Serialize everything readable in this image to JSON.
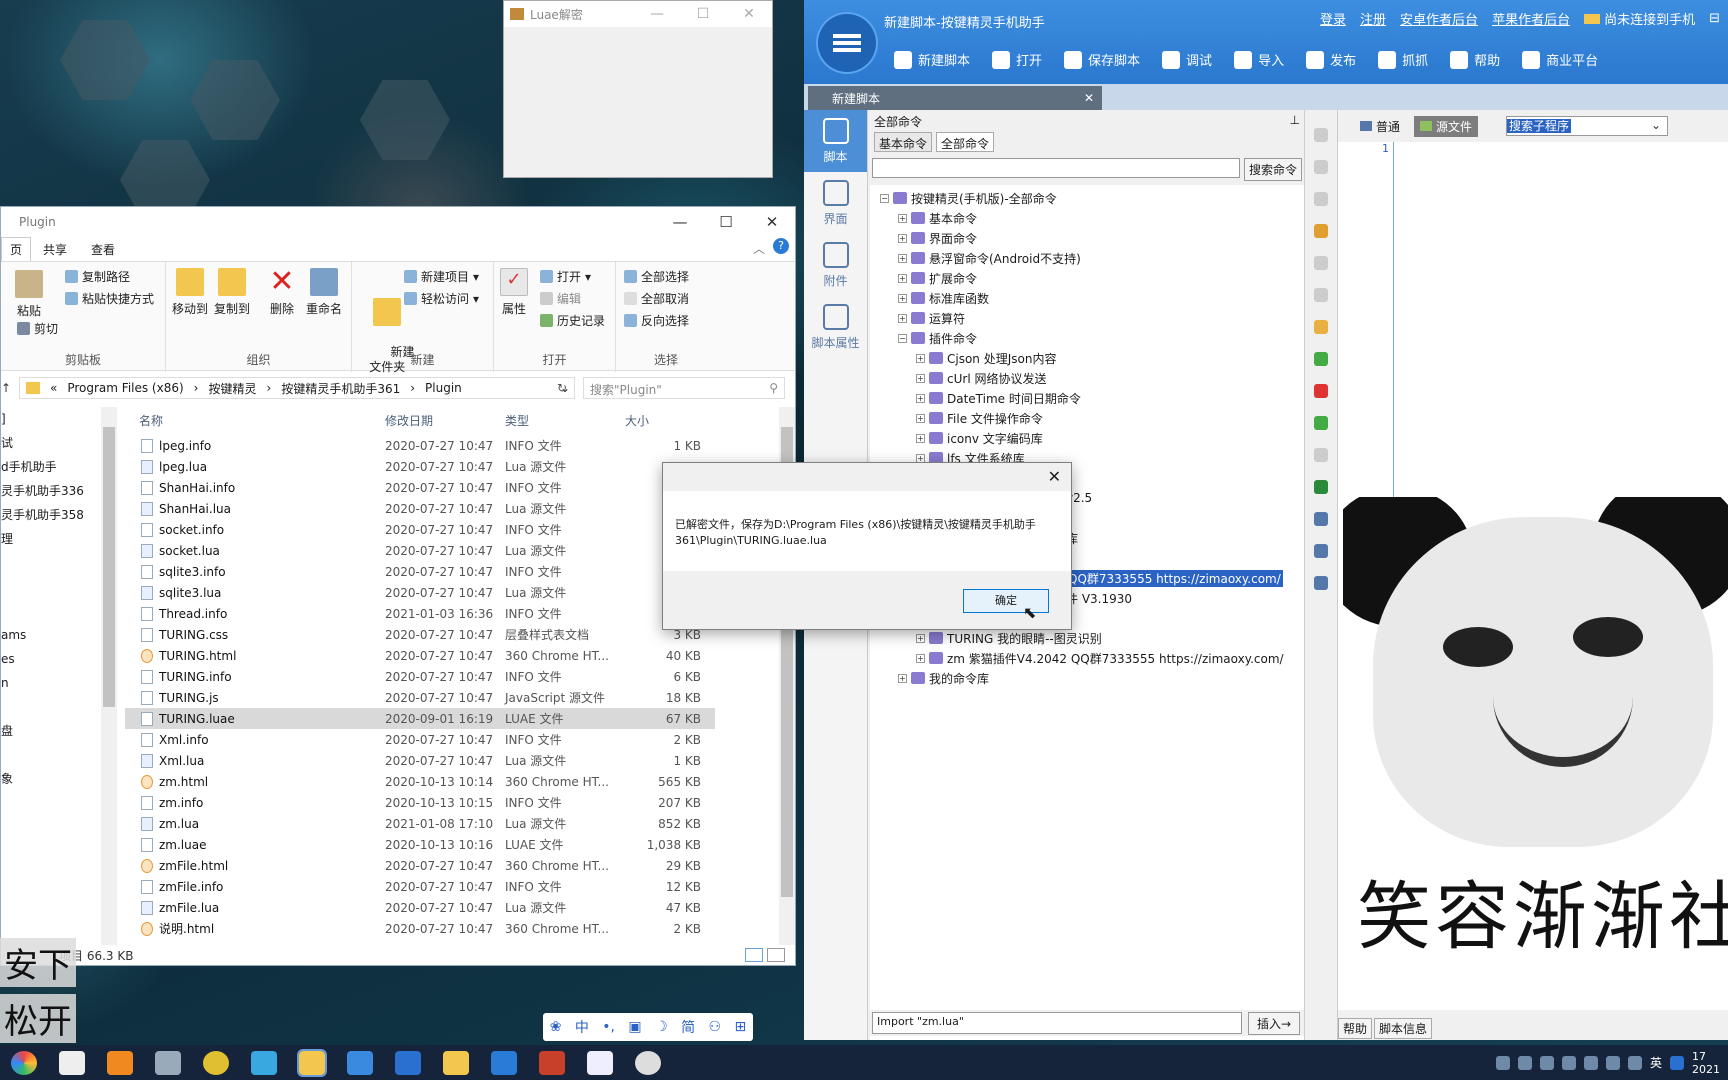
{
  "luae_window": {
    "title": "Luae解密"
  },
  "explorer": {
    "title": "Plugin",
    "tabs": [
      "页",
      "共享",
      "查看"
    ],
    "ribbon": {
      "clipboard": {
        "label": "剪贴板",
        "paste": "粘贴",
        "copy_path": "复制路径",
        "paste_shortcut": "粘贴快捷方式",
        "cut": "剪切"
      },
      "organize": {
        "label": "组织",
        "move_to": "移动到",
        "copy_to": "复制到",
        "delete": "删除",
        "rename": "重命名"
      },
      "new": {
        "label": "新建",
        "new_folder": "新建\n文件夹",
        "new_item": "新建项目",
        "easy_access": "轻松访问"
      },
      "open": {
        "label": "打开",
        "properties": "属性",
        "open": "打开",
        "edit": "编辑",
        "history": "历史记录"
      },
      "select": {
        "label": "选择",
        "select_all": "全部选择",
        "select_none": "全部取消",
        "invert": "反向选择"
      }
    },
    "path": [
      "«",
      "Program Files (x86)",
      "按键精灵",
      "按键精灵手机助手361",
      "Plugin"
    ],
    "search_placeholder": "搜索\"Plugin\"",
    "nav_items": [
      "]",
      "试",
      "d手机助手",
      "灵手机助手336",
      "灵手机助手358",
      "理",
      "",
      "",
      "",
      "ams",
      "es",
      "n",
      "",
      "盘",
      "",
      "象"
    ],
    "columns": [
      "名称",
      "修改日期",
      "类型",
      "大小"
    ],
    "files": [
      {
        "name": "lpeg.info",
        "date": "2020-07-27 10:47",
        "type": "INFO 文件",
        "size": "1 KB",
        "icon": "info"
      },
      {
        "name": "lpeg.lua",
        "date": "2020-07-27 10:47",
        "type": "Lua 源文件",
        "size": "",
        "icon": "lua"
      },
      {
        "name": "ShanHai.info",
        "date": "2020-07-27 10:47",
        "type": "INFO 文件",
        "size": "",
        "icon": "info"
      },
      {
        "name": "ShanHai.lua",
        "date": "2020-07-27 10:47",
        "type": "Lua 源文件",
        "size": "",
        "icon": "lua"
      },
      {
        "name": "socket.info",
        "date": "2020-07-27 10:47",
        "type": "INFO 文件",
        "size": "",
        "icon": "info"
      },
      {
        "name": "socket.lua",
        "date": "2020-07-27 10:47",
        "type": "Lua 源文件",
        "size": "",
        "icon": "lua"
      },
      {
        "name": "sqlite3.info",
        "date": "2020-07-27 10:47",
        "type": "INFO 文件",
        "size": "",
        "icon": "info"
      },
      {
        "name": "sqlite3.lua",
        "date": "2020-07-27 10:47",
        "type": "Lua 源文件",
        "size": "",
        "icon": "lua"
      },
      {
        "name": "Thread.info",
        "date": "2021-01-03 16:36",
        "type": "INFO 文件",
        "size": "",
        "icon": "info"
      },
      {
        "name": "TURING.css",
        "date": "2020-07-27 10:47",
        "type": "层叠样式表文档",
        "size": "3 KB",
        "icon": "info"
      },
      {
        "name": "TURING.html",
        "date": "2020-07-27 10:47",
        "type": "360 Chrome HT...",
        "size": "40 KB",
        "icon": "html"
      },
      {
        "name": "TURING.info",
        "date": "2020-07-27 10:47",
        "type": "INFO 文件",
        "size": "6 KB",
        "icon": "info"
      },
      {
        "name": "TURING.js",
        "date": "2020-07-27 10:47",
        "type": "JavaScript 源文件",
        "size": "18 KB",
        "icon": "info"
      },
      {
        "name": "TURING.luae",
        "date": "2020-09-01 16:19",
        "type": "LUAE 文件",
        "size": "67 KB",
        "icon": "info",
        "selected": true
      },
      {
        "name": "Xml.info",
        "date": "2020-07-27 10:47",
        "type": "INFO 文件",
        "size": "2 KB",
        "icon": "info"
      },
      {
        "name": "Xml.lua",
        "date": "2020-07-27 10:47",
        "type": "Lua 源文件",
        "size": "1 KB",
        "icon": "lua"
      },
      {
        "name": "zm.html",
        "date": "2020-10-13 10:14",
        "type": "360 Chrome HT...",
        "size": "565 KB",
        "icon": "html"
      },
      {
        "name": "zm.info",
        "date": "2020-10-13 10:15",
        "type": "INFO 文件",
        "size": "207 KB",
        "icon": "info"
      },
      {
        "name": "zm.lua",
        "date": "2021-01-08 17:10",
        "type": "Lua 源文件",
        "size": "852 KB",
        "icon": "lua"
      },
      {
        "name": "zm.luae",
        "date": "2020-10-13 10:16",
        "type": "LUAE 文件",
        "size": "1,038 KB",
        "icon": "info"
      },
      {
        "name": "zmFile.html",
        "date": "2020-07-27 10:47",
        "type": "360 Chrome HT...",
        "size": "29 KB",
        "icon": "html"
      },
      {
        "name": "zmFile.info",
        "date": "2020-07-27 10:47",
        "type": "INFO 文件",
        "size": "12 KB",
        "icon": "info"
      },
      {
        "name": "zmFile.lua",
        "date": "2020-07-27 10:47",
        "type": "Lua 源文件",
        "size": "47 KB",
        "icon": "lua"
      },
      {
        "name": "说明.html",
        "date": "2020-07-27 10:47",
        "type": "360 Chrome HT...",
        "size": "2 KB",
        "icon": "html"
      }
    ],
    "status": "项目  66.3 KB"
  },
  "app": {
    "title": "新建脚本-按键精灵手机助手",
    "links": [
      "登录",
      "注册",
      "安卓作者后台",
      "苹果作者后台"
    ],
    "connect_status": "尚未连接到手机",
    "toolbar": [
      "新建脚本",
      "打开",
      "保存脚本",
      "调试",
      "导入",
      "发布",
      "抓抓",
      "帮助",
      "商业平台"
    ],
    "doc_tab": "新建脚本",
    "side_nav": [
      "脚本",
      "界面",
      "附件",
      "脚本属性"
    ],
    "pane_header": "全部命令",
    "subtabs": [
      "基本命令",
      "全部命令"
    ],
    "search_button": "搜索命令",
    "tree": [
      {
        "label": "按键精灵(手机版)-全部命令",
        "level": 0,
        "sign": "−"
      },
      {
        "label": "基本命令",
        "level": 1,
        "sign": "+"
      },
      {
        "label": "界面命令",
        "level": 1,
        "sign": "+"
      },
      {
        "label": "悬浮窗命令(Android不支持)",
        "level": 1,
        "sign": "+"
      },
      {
        "label": "扩展命令",
        "level": 1,
        "sign": "+"
      },
      {
        "label": "标准库函数",
        "level": 1,
        "sign": "+"
      },
      {
        "label": "运算符",
        "level": 1,
        "sign": "+"
      },
      {
        "label": "插件命令",
        "level": 1,
        "sign": "−"
      },
      {
        "label": "Cjson 处理Json内容",
        "level": 2,
        "sign": "+"
      },
      {
        "label": "cUrl 网络协议发送",
        "level": 2,
        "sign": "+"
      },
      {
        "label": "DateTime 时间日期命令",
        "level": 2,
        "sign": "+"
      },
      {
        "label": "File 文件操作命令",
        "level": 2,
        "sign": "+"
      },
      {
        "label": "iconv 文字编码库",
        "level": 2,
        "sign": "+"
      },
      {
        "label": "lfs 文件系统库",
        "level": 2,
        "sign": "+"
      },
      {
        "label": "",
        "level": 2,
        "sign": ""
      },
      {
        "label": "v2.5",
        "level": 2,
        "sign": "",
        "offset": true
      },
      {
        "label": "",
        "level": 2,
        "sign": ""
      },
      {
        "label": "库",
        "level": 2,
        "sign": "",
        "offset": true
      },
      {
        "label": "",
        "level": 2,
        "sign": ""
      },
      {
        "label": "QQ群7333555 https://zimaoxy.com/",
        "level": 2,
        "sign": "",
        "offset": true,
        "highlight": true
      },
      {
        "label": "件 V3.1930",
        "level": 2,
        "sign": "",
        "offset": true
      },
      {
        "label": "",
        "level": 2,
        "sign": ""
      },
      {
        "label": "TURING 我的眼睛--图灵识别",
        "level": 2,
        "sign": "+"
      },
      {
        "label": "zm 紫猫插件V4.2042 QQ群7333555 https://zimaoxy.com/",
        "level": 2,
        "sign": "+"
      },
      {
        "label": "我的命令库",
        "level": 1,
        "sign": "+"
      }
    ],
    "command_input": "Import \"zm.lua\"",
    "insert_button": "插入→",
    "editor_modes": [
      "普通",
      "源文件"
    ],
    "subroutine_select": "搜索子程序",
    "line_number": "1",
    "bottom_tabs": [
      "帮助",
      "脚本信息"
    ]
  },
  "dialog": {
    "message": "已解密文件，保存为D:\\Program Files (x86)\\按键精灵\\按键精灵手机助手361\\Plugin\\TURING.luae.lua",
    "ok_label": "确定"
  },
  "meme_caption": "笑容渐渐社会",
  "ime_items": [
    "中",
    "简"
  ],
  "overlay_text": [
    "安下",
    "松开"
  ],
  "clock": {
    "time": "17",
    "year": "2021"
  },
  "tray_lang": "英"
}
